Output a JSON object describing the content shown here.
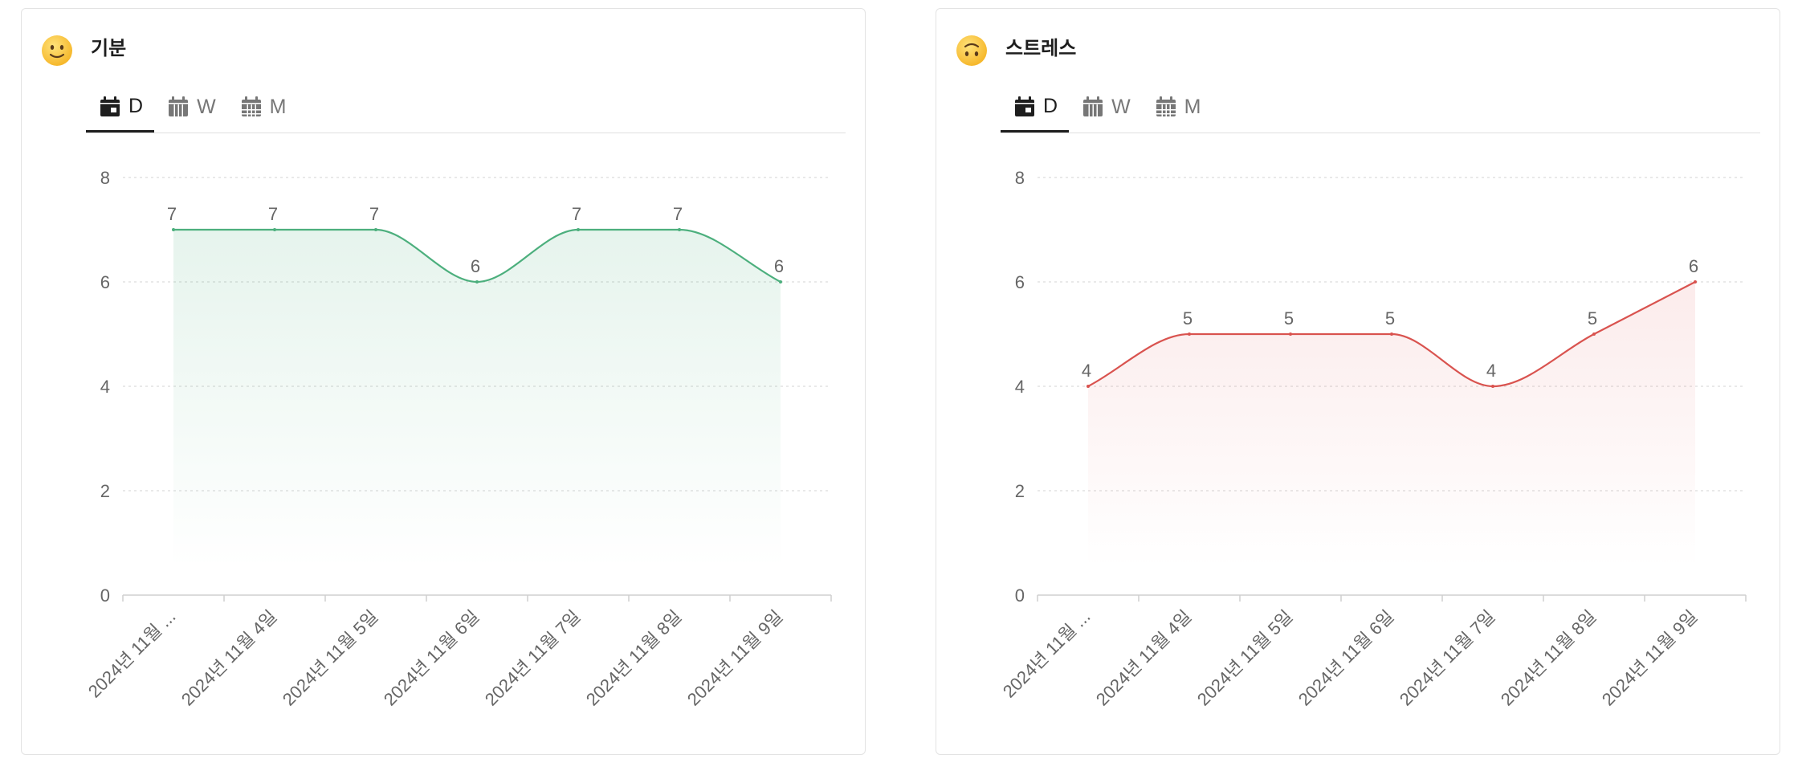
{
  "tabs": [
    {
      "label": "D",
      "icon": "calendar-day-icon",
      "active": true
    },
    {
      "label": "W",
      "icon": "calendar-week-icon",
      "active": false
    },
    {
      "label": "M",
      "icon": "calendar-month-icon",
      "active": false
    }
  ],
  "cards": [
    {
      "title": "기분",
      "icon": "slightly-smiling-face-icon",
      "line_color": "#4caf7d",
      "fill_color": "#4caf7d"
    },
    {
      "title": "스트레스",
      "icon": "upside-down-face-icon",
      "line_color": "#d9534f",
      "fill_color": "#e57373"
    }
  ],
  "chart_data": [
    {
      "type": "area",
      "title": "기분",
      "categories": [
        "2024년 11월 ...",
        "2024년 11월 4일",
        "2024년 11월 5일",
        "2024년 11월 6일",
        "2024년 11월 7일",
        "2024년 11월 8일",
        "2024년 11월 9일"
      ],
      "values": [
        7,
        7,
        7,
        6,
        7,
        7,
        6
      ],
      "data_labels": [
        "7",
        "7",
        "7",
        "6",
        "7",
        "7",
        "6"
      ],
      "y_ticks": [
        "0",
        "2",
        "4",
        "6",
        "8"
      ],
      "ylim": [
        0,
        8
      ],
      "grid": true,
      "legend": "none",
      "smooth": true
    },
    {
      "type": "area",
      "title": "스트레스",
      "categories": [
        "2024년 11월 ...",
        "2024년 11월 4일",
        "2024년 11월 5일",
        "2024년 11월 6일",
        "2024년 11월 7일",
        "2024년 11월 8일",
        "2024년 11월 9일"
      ],
      "values": [
        4,
        5,
        5,
        5,
        4,
        5,
        6
      ],
      "data_labels": [
        "4",
        "5",
        "5",
        "5",
        "4",
        "5",
        "6"
      ],
      "y_ticks": [
        "0",
        "2",
        "4",
        "6",
        "8"
      ],
      "ylim": [
        0,
        8
      ],
      "grid": true,
      "legend": "none",
      "smooth": true
    }
  ]
}
